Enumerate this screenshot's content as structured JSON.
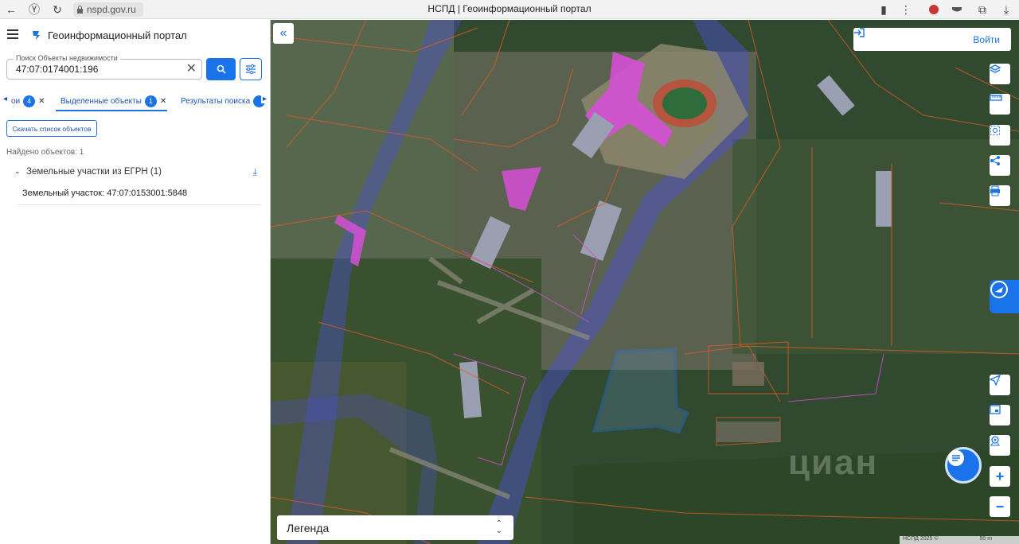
{
  "browser": {
    "url": "nspd.gov.ru",
    "tab_title": "НСПД | Геоинформационный портал"
  },
  "app": {
    "title": "Геоинформационный портал"
  },
  "search": {
    "legend": "Поиск Объекты недвижимости",
    "value": "47:07:0174001:196"
  },
  "tabs": [
    {
      "label": "ои",
      "count": "4"
    },
    {
      "label": "Выделенные объекты",
      "count": "1"
    },
    {
      "label": "Результаты поиска",
      "count": ""
    }
  ],
  "results": {
    "download_label": "Скачать список объектов",
    "found_text": "Найдено объектов: 1",
    "group_label": "Земельные участки из ЕГРН (1)",
    "item_label": "Земельный участок: 47:07:0153001:5848"
  },
  "map": {
    "login_label": "Войти",
    "legend_label": "Легенда",
    "attribution": "НСПД 2025 ©",
    "scale": "50 m",
    "watermark": "циан",
    "colors": {
      "accent": "#1a73e8",
      "parcel_border": "#e05a2a",
      "building_fill": "#d64fd6",
      "water_overlay": "#4b4fd6",
      "selected_parcel": "#1f7bff"
    }
  }
}
